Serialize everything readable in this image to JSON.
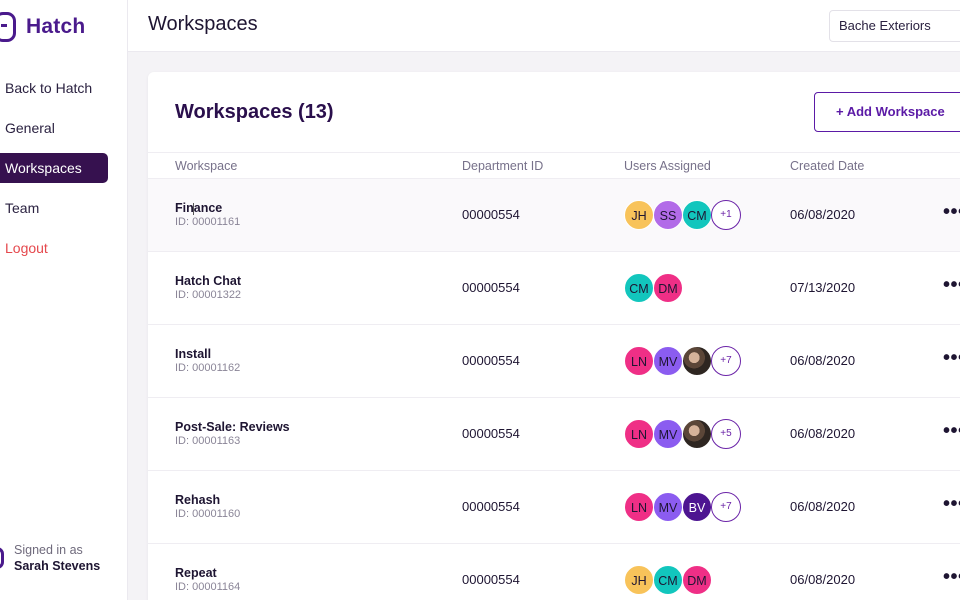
{
  "app": {
    "name": "Hatch"
  },
  "sidebar": {
    "items": [
      {
        "label": "Back to Hatch"
      },
      {
        "label": "General"
      },
      {
        "label": "Workspaces"
      },
      {
        "label": "Team"
      },
      {
        "label": "Logout"
      }
    ],
    "active_index": 2,
    "signed_in_label": "Signed in as",
    "user_name": "Sarah Stevens"
  },
  "header": {
    "title": "Workspaces",
    "org_selector": "Bache Exteriors"
  },
  "main": {
    "title": "Workspaces (13)",
    "add_button": "+ Add Workspace",
    "columns": [
      "Workspace",
      "Department ID",
      "Users Assigned",
      "Created Date"
    ],
    "rows": [
      {
        "name": "Finance",
        "id": "ID: 00001161",
        "dept": "00000554",
        "date": "06/08/2020",
        "users": [
          "JH",
          "SS",
          "CM"
        ],
        "more": "+1"
      },
      {
        "name": "Hatch Chat",
        "id": "ID: 00001322",
        "dept": "00000554",
        "date": "07/13/2020",
        "users": [
          "CM",
          "DM"
        ],
        "more": ""
      },
      {
        "name": "Install",
        "id": "ID: 00001162",
        "dept": "00000554",
        "date": "06/08/2020",
        "users": [
          "LN",
          "MV",
          ""
        ],
        "more": "+7"
      },
      {
        "name": "Post-Sale: Reviews",
        "id": "ID: 00001163",
        "dept": "00000554",
        "date": "06/08/2020",
        "users": [
          "LN",
          "MV",
          ""
        ],
        "more": "+5"
      },
      {
        "name": "Rehash",
        "id": "ID: 00001160",
        "dept": "00000554",
        "date": "06/08/2020",
        "users": [
          "LN",
          "MV",
          "BV"
        ],
        "more": "+7"
      },
      {
        "name": "Repeat",
        "id": "ID: 00001164",
        "dept": "00000554",
        "date": "06/08/2020",
        "users": [
          "JH",
          "CM",
          "DM"
        ],
        "more": ""
      }
    ],
    "row_menu": "•••"
  },
  "avatar_colors": {
    "JH": "#f8c35a",
    "SS": "#b26be8",
    "CM": "#12c6bd",
    "DM": "#ef2f86",
    "LN": "#ef2f86",
    "MV": "#8b5cf0",
    "BV": "#4d1591"
  }
}
